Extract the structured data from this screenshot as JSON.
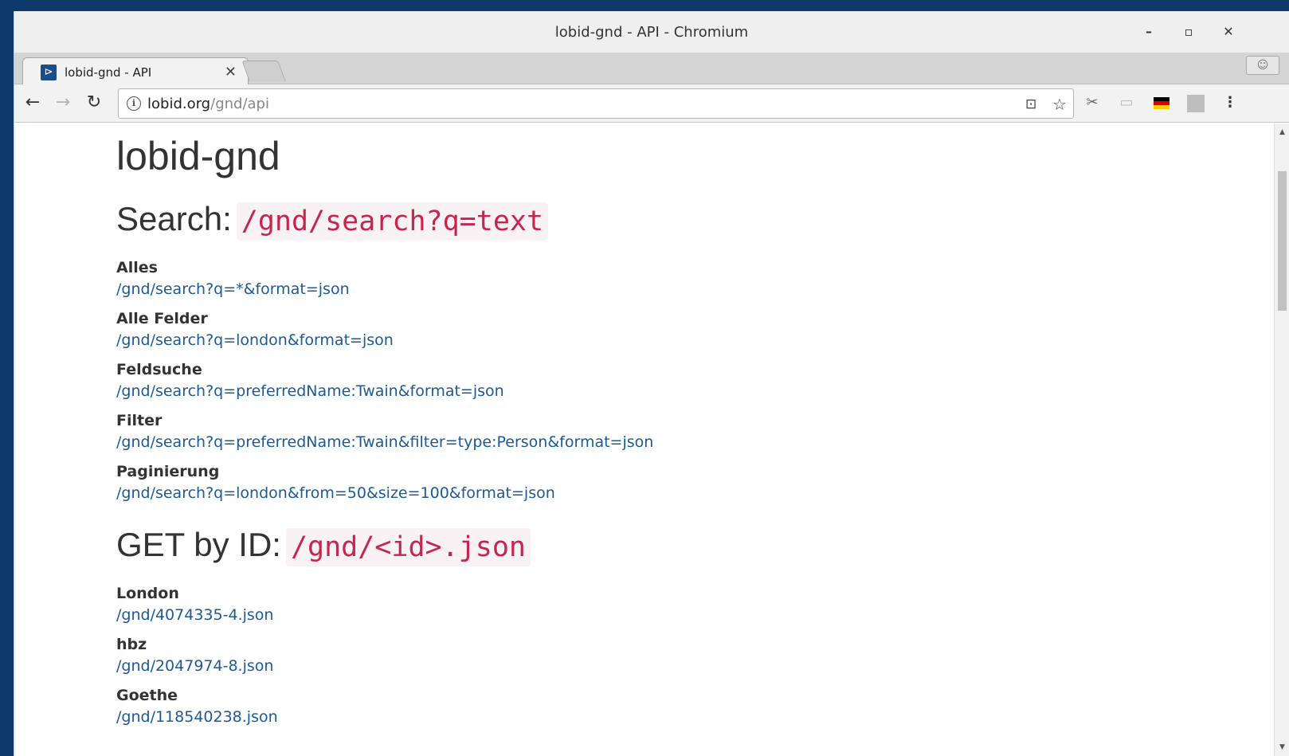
{
  "window": {
    "title": "lobid-gnd - API - Chromium",
    "minimize": "–",
    "maximize": "▫",
    "close": "✕"
  },
  "tab": {
    "title": "lobid-gnd - API",
    "close": "✕"
  },
  "toolbar": {
    "url_host": "lobid.org",
    "url_path": "/gnd/api"
  },
  "page": {
    "heading": "lobid-gnd",
    "search_section": {
      "label": "Search:",
      "code": "/gnd/search?q=text",
      "items": [
        {
          "term": "Alles",
          "link": "/gnd/search?q=*&format=json"
        },
        {
          "term": "Alle Felder",
          "link": "/gnd/search?q=london&format=json"
        },
        {
          "term": "Feldsuche",
          "link": "/gnd/search?q=preferredName:Twain&format=json"
        },
        {
          "term": "Filter",
          "link": "/gnd/search?q=preferredName:Twain&filter=type:Person&format=json"
        },
        {
          "term": "Paginierung",
          "link": "/gnd/search?q=london&from=50&size=100&format=json"
        }
      ]
    },
    "get_section": {
      "label": "GET by ID:",
      "code": "/gnd/<id>.json",
      "items": [
        {
          "term": "London",
          "link": "/gnd/4074335-4.json"
        },
        {
          "term": "hbz",
          "link": "/gnd/2047974-8.json"
        },
        {
          "term": "Goethe",
          "link": "/gnd/118540238.json"
        }
      ]
    }
  },
  "colors": {
    "desktop": "#0d3a6b",
    "link": "#1b5a96",
    "code": "#c7254e",
    "code_bg": "#f9f2f4"
  }
}
